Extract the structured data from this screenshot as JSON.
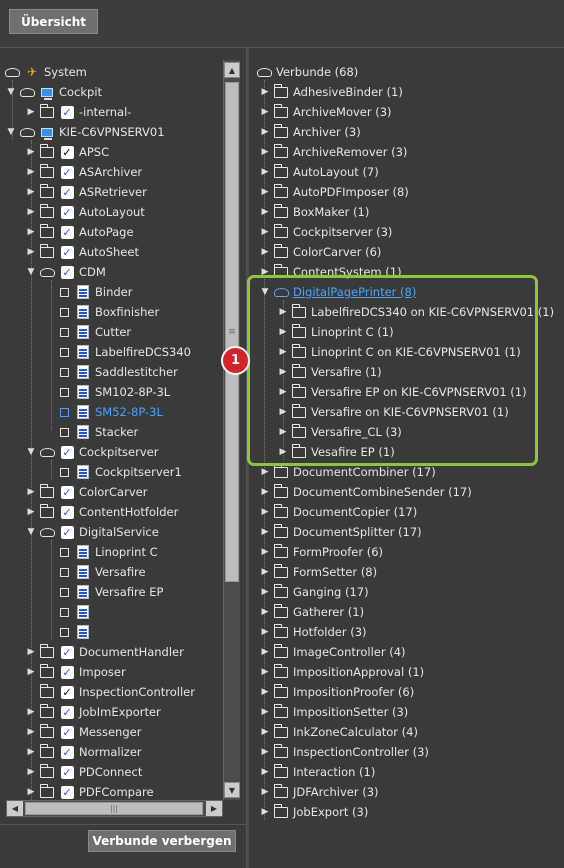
{
  "header": {
    "overview_button": "Übersicht"
  },
  "left_tree": {
    "items": [
      {
        "label": "System",
        "icon": "system-icon"
      },
      {
        "label": "Cockpit",
        "icon": "computer-icon"
      },
      {
        "label": "-internal-",
        "icon": "check-icon"
      },
      {
        "label": "KIE-C6VPNSERV01",
        "icon": "computer-icon"
      },
      {
        "label": "APSC",
        "icon": "check-dark-icon"
      },
      {
        "label": "ASArchiver",
        "icon": "check-icon"
      },
      {
        "label": "ASRetriever",
        "icon": "check-icon"
      },
      {
        "label": "AutoLayout",
        "icon": "check-icon"
      },
      {
        "label": "AutoPage",
        "icon": "check-icon"
      },
      {
        "label": "AutoSheet",
        "icon": "check-icon"
      },
      {
        "label": "CDM",
        "icon": "check-icon"
      },
      {
        "label": "Binder",
        "icon": "device-icon"
      },
      {
        "label": "Boxfinisher",
        "icon": "device-icon"
      },
      {
        "label": "Cutter",
        "icon": "device-icon"
      },
      {
        "label": "LabelfireDCS340",
        "icon": "device-icon"
      },
      {
        "label": "Saddlestitcher",
        "icon": "device-icon"
      },
      {
        "label": "SM102-8P-3L",
        "icon": "device-icon"
      },
      {
        "label": "SM52-8P-3L",
        "icon": "device-icon"
      },
      {
        "label": "Stacker",
        "icon": "device-icon"
      },
      {
        "label": "Cockpitserver",
        "icon": "check-icon"
      },
      {
        "label": "Cockpitserver1",
        "icon": "device-icon"
      },
      {
        "label": "ColorCarver",
        "icon": "check-icon"
      },
      {
        "label": "ContentHotfolder",
        "icon": "check-icon"
      },
      {
        "label": "DigitalService",
        "icon": "check-icon"
      },
      {
        "label": "Linoprint C",
        "icon": "device-icon"
      },
      {
        "label": "Versafire",
        "icon": "device-icon"
      },
      {
        "label": "Versafire EP",
        "icon": "device-icon"
      },
      {
        "label": "",
        "icon": "device-icon"
      },
      {
        "label": "",
        "icon": "device-icon"
      },
      {
        "label": "DocumentHandler",
        "icon": "check-icon"
      },
      {
        "label": "Imposer",
        "icon": "check-icon"
      },
      {
        "label": "InspectionController",
        "icon": "check-dark-icon"
      },
      {
        "label": "JobImExporter",
        "icon": "check-icon"
      },
      {
        "label": "Messenger",
        "icon": "check-icon"
      },
      {
        "label": "Normalizer",
        "icon": "check-icon"
      },
      {
        "label": "PDConnect",
        "icon": "check-icon"
      },
      {
        "label": "PDFCompare",
        "icon": "check-icon"
      }
    ]
  },
  "right_tree": {
    "items": [
      {
        "label": "Verbunde (68)"
      },
      {
        "label": "AdhesiveBinder (1)"
      },
      {
        "label": "ArchiveMover (3)"
      },
      {
        "label": "Archiver (3)"
      },
      {
        "label": "ArchiveRemover (3)"
      },
      {
        "label": "AutoLayout (7)"
      },
      {
        "label": "AutoPDFImposer (8)"
      },
      {
        "label": "BoxMaker (1)"
      },
      {
        "label": "Cockpitserver (3)"
      },
      {
        "label": "ColorCarver (6)"
      },
      {
        "label": "ContentSystem (1)"
      },
      {
        "label": "DigitalPagePrinter (8)"
      },
      {
        "label": "LabelfireDCS340 on KIE-C6VPNSERV01 (1)"
      },
      {
        "label": "Linoprint C (1)"
      },
      {
        "label": "Linoprint C on KIE-C6VPNSERV01 (1)"
      },
      {
        "label": "Versafire (1)"
      },
      {
        "label": "Versafire EP on KIE-C6VPNSERV01 (1)"
      },
      {
        "label": "Versafire on KIE-C6VPNSERV01 (1)"
      },
      {
        "label": "Versafire_CL (3)"
      },
      {
        "label": "Vesafire EP (1)"
      },
      {
        "label": "DocumentCombiner (17)"
      },
      {
        "label": "DocumentCombineSender (17)"
      },
      {
        "label": "DocumentCopier (17)"
      },
      {
        "label": "DocumentSplitter (17)"
      },
      {
        "label": "FormProofer (6)"
      },
      {
        "label": "FormSetter (8)"
      },
      {
        "label": "Ganging (17)"
      },
      {
        "label": "Gatherer (1)"
      },
      {
        "label": "Hotfolder (3)"
      },
      {
        "label": "ImageController (4)"
      },
      {
        "label": "ImpositionApproval (1)"
      },
      {
        "label": "ImpositionProofer (6)"
      },
      {
        "label": "ImpositionSetter (3)"
      },
      {
        "label": "InkZoneCalculator (4)"
      },
      {
        "label": "InspectionController (3)"
      },
      {
        "label": "Interaction (1)"
      },
      {
        "label": "JDFArchiver (3)"
      },
      {
        "label": "JobExport (3)"
      }
    ]
  },
  "footer": {
    "hide_button": "Verbunde verbergen"
  },
  "callout": {
    "number": "1"
  },
  "colors": {
    "accent": "#4aa3ff",
    "highlight_frame": "#8cc63f",
    "marker": "#d4242b"
  }
}
